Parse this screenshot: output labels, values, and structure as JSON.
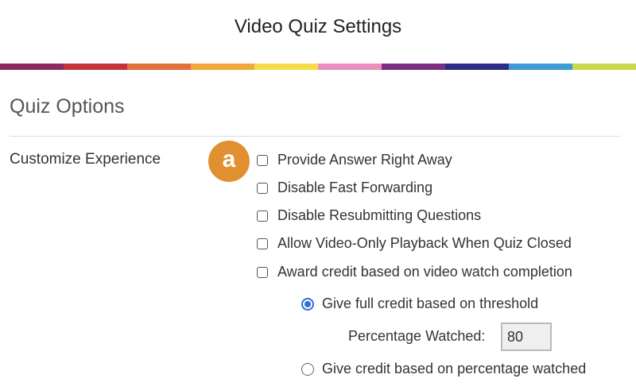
{
  "header": {
    "title": "Video Quiz Settings"
  },
  "color_bar": [
    "#8b2a5c",
    "#c33439",
    "#e2703a",
    "#f2a93c",
    "#f5dd48",
    "#e88fbd",
    "#7a2f83",
    "#2c2c86",
    "#3f9bd8",
    "#c9d94b"
  ],
  "section": {
    "title": "Quiz Options"
  },
  "customize": {
    "label": "Customize Experience",
    "badge": "a",
    "options": [
      {
        "label": "Provide Answer Right Away",
        "checked": false
      },
      {
        "label": "Disable Fast Forwarding",
        "checked": false
      },
      {
        "label": "Disable Resubmitting Questions",
        "checked": false
      },
      {
        "label": "Allow Video-Only Playback When Quiz Closed",
        "checked": false
      },
      {
        "label": "Award credit based on video watch completion",
        "checked": false
      }
    ],
    "credit_modes": [
      {
        "label": "Give full credit based on threshold",
        "selected": true
      },
      {
        "label": "Give credit based on percentage watched",
        "selected": false
      }
    ],
    "percentage": {
      "label": "Percentage Watched:",
      "value": "80"
    }
  },
  "colors": {
    "badge": "#e0902f",
    "radio_selected": "#2f6fd6"
  }
}
